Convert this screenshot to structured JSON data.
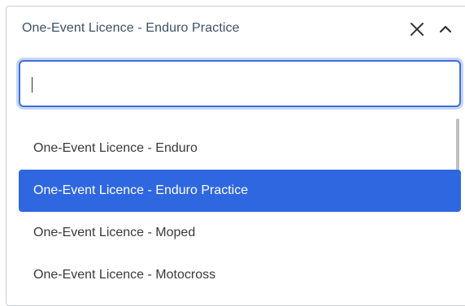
{
  "dropdown": {
    "selected_value": "One-Event Licence - Enduro Practice",
    "clear_icon": "close-icon",
    "collapse_icon": "chevron-up-icon"
  },
  "search": {
    "value": "",
    "placeholder": ""
  },
  "options": [
    {
      "label": "One-Event Licence - Enduro",
      "active": false
    },
    {
      "label": "One-Event Licence - Enduro Practice",
      "active": true
    },
    {
      "label": "One-Event Licence - Moped",
      "active": false
    },
    {
      "label": "One-Event Licence - Motocross",
      "active": false
    }
  ],
  "colors": {
    "accent": "#2f67e0",
    "focus_ring": "#c7d6f8",
    "border": "#c9ccd1"
  }
}
